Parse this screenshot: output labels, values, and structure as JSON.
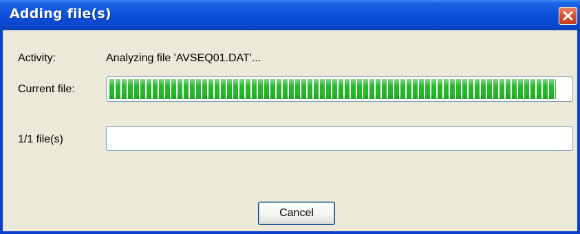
{
  "window": {
    "title": "Adding file(s)"
  },
  "activity": {
    "label": "Activity:",
    "value": "Analyzing file 'AVSEQ01.DAT'..."
  },
  "current_file": {
    "label": "Current file:",
    "progress": 0.99
  },
  "total": {
    "label": "1/1 file(s)",
    "progress": 0
  },
  "buttons": {
    "cancel_label": "Cancel"
  },
  "colors": {
    "titlebar": "#0b4fdb",
    "progress_fill": "#26b82a",
    "dialog_face": "#ece9d8"
  },
  "icons": {
    "close": "close-icon"
  }
}
